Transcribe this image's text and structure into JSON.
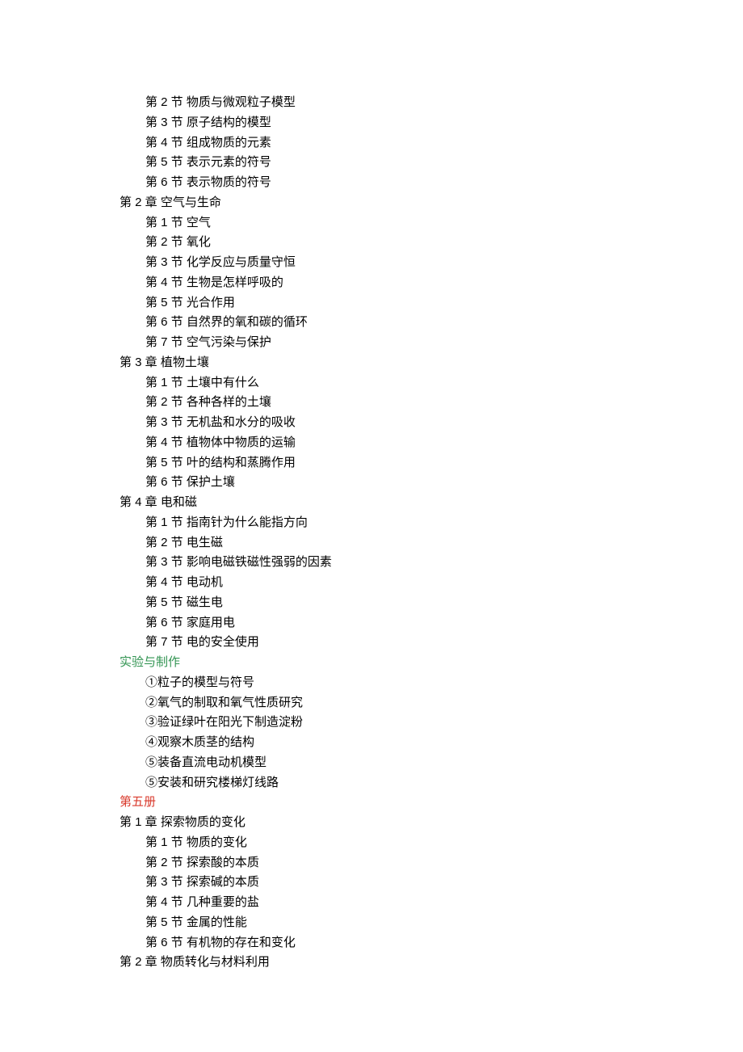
{
  "top_sections": [
    "第 2 节  物质与微观粒子模型",
    "第 3 节  原子结构的模型",
    "第 4 节  组成物质的元素",
    "第 5 节  表示元素的符号",
    "第 6 节  表示物质的符号"
  ],
  "chapters": [
    {
      "title": "第 2 章  空气与生命",
      "sections": [
        "第 1 节  空气",
        "第 2 节  氧化",
        "第 3 节  化学反应与质量守恒",
        "第 4 节  生物是怎样呼吸的",
        "第 5 节  光合作用",
        "第 6 节  自然界的氧和碳的循环",
        "第 7 节  空气污染与保护"
      ]
    },
    {
      "title": "第 3 章  植物土壤",
      "sections": [
        "第 1 节  土壤中有什么",
        "第 2 节  各种各样的土壤",
        "第 3 节  无机盐和水分的吸收",
        "第 4 节  植物体中物质的运输",
        "第 5 节  叶的结构和蒸腾作用",
        "第 6 节  保护土壤"
      ]
    },
    {
      "title": "第 4 章  电和磁",
      "sections": [
        "第 1 节  指南针为什么能指方向",
        "第 2 节  电生磁",
        "第 3 节  影响电磁铁磁性强弱的因素",
        "第 4 节  电动机",
        "第 5 节  磁生电",
        "第 6 节  家庭用电",
        "第 7 节  电的安全使用"
      ]
    }
  ],
  "experiments": {
    "header": "实验与制作",
    "items": [
      "①粒子的模型与符号",
      "②氧气的制取和氧气性质研究",
      "③验证绿叶在阳光下制造淀粉",
      "④观察木质茎的结构",
      "⑤装备直流电动机模型",
      "⑤安装和研究楼梯灯线路"
    ]
  },
  "volume5": {
    "header": "第五册",
    "chapters": [
      {
        "title": "第 1 章  探索物质的变化",
        "sections": [
          "第 1 节  物质的变化",
          "第 2 节  探索酸的本质",
          "第 3 节  探索碱的本质",
          "第 4 节  几种重要的盐",
          "第 5 节  金属的性能",
          "第 6 节  有机物的存在和变化"
        ]
      },
      {
        "title": "第 2 章  物质转化与材料利用",
        "sections": []
      }
    ]
  }
}
